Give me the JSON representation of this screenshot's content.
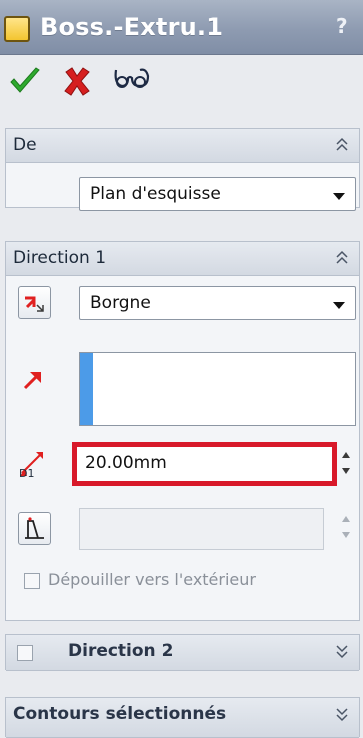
{
  "title_bar": {
    "title": "Boss.-Extru.1",
    "help_label": "?"
  },
  "toolbar": {
    "ok_icon": "green-check-icon",
    "cancel_icon": "red-x-icon",
    "preview_icon": "glasses-icon"
  },
  "sections": {
    "from": {
      "title": "De",
      "start_condition": "Plan d'esquisse"
    },
    "direction1": {
      "title": "Direction 1",
      "end_condition": "Borgne",
      "depth_value": "20.00mm",
      "depth_label": "D1",
      "draft_outward_label": "Dépouiller vers l'extérieur"
    },
    "direction2": {
      "title": "Direction 2",
      "checked": false
    },
    "selected_contours": {
      "title": "Contours sélectionnés"
    }
  },
  "colors": {
    "highlight_border": "#d8192a",
    "selection_box_accent": "#4c9be8",
    "direction_arrow": "#e02020"
  }
}
